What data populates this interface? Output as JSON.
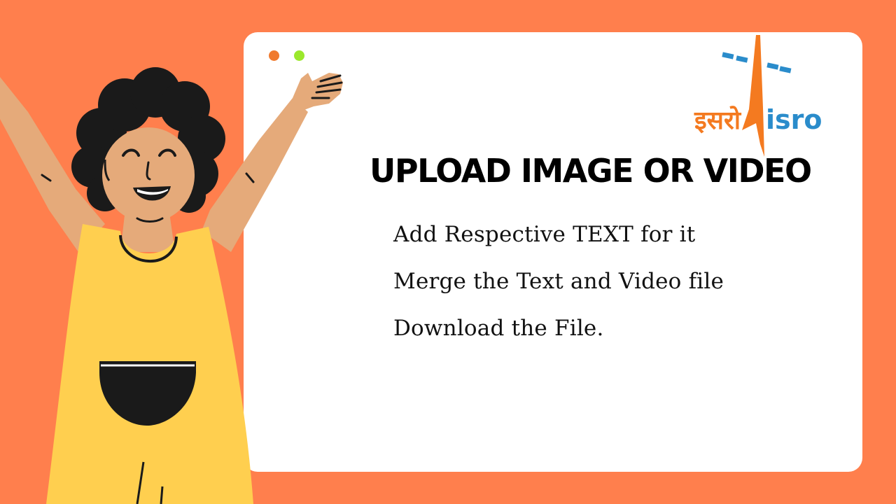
{
  "colors": {
    "background": "#FF7F4D",
    "card": "#FFFFFF",
    "dot_orange": "#F07A2E",
    "dot_green": "#9BE82C",
    "logo_orange": "#F47A20",
    "logo_blue": "#2A8CCB",
    "skin": "#E5AA7A",
    "dress": "#FFCF4F",
    "hair": "#1A1A1A"
  },
  "logo": {
    "hindi_text": "इसरो",
    "latin_text": "isro"
  },
  "heading": "UPLOAD IMAGE OR VIDEO",
  "steps": [
    "Add Respective TEXT for it",
    "Merge the Text and Video file",
    "Download the File."
  ],
  "icons": [
    "isro-logo-icon",
    "person-illustration",
    "window-dot-orange",
    "window-dot-green"
  ]
}
